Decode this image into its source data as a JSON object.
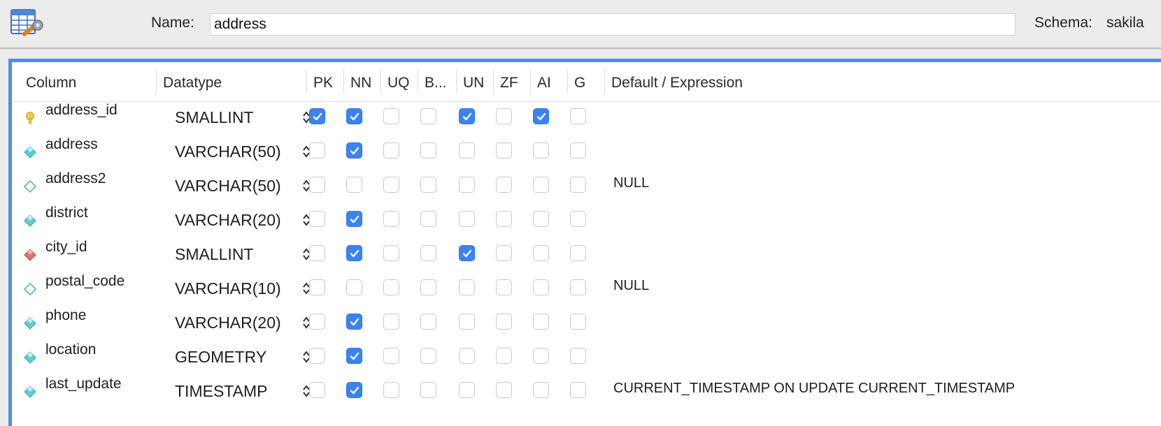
{
  "header": {
    "name_label": "Name:",
    "name_value": "address",
    "schema_label": "Schema:",
    "schema_value": "sakila",
    "icon": "table-edit-icon"
  },
  "grid": {
    "headers": {
      "column": "Column",
      "datatype": "Datatype",
      "pk": "PK",
      "nn": "NN",
      "uq": "UQ",
      "b": "B...",
      "un": "UN",
      "zf": "ZF",
      "ai": "AI",
      "g": "G",
      "default": "Default / Expression"
    },
    "rows": [
      {
        "name": "address_id",
        "datatype": "SMALLINT",
        "icon": "primary-key-icon",
        "pk": true,
        "nn": true,
        "uq": false,
        "b": false,
        "un": true,
        "zf": false,
        "ai": true,
        "g": false,
        "default": ""
      },
      {
        "name": "address",
        "datatype": "VARCHAR(50)",
        "icon": "column-not-null-icon",
        "pk": false,
        "nn": true,
        "uq": false,
        "b": false,
        "un": false,
        "zf": false,
        "ai": false,
        "g": false,
        "default": ""
      },
      {
        "name": "address2",
        "datatype": "VARCHAR(50)",
        "icon": "column-nullable-icon",
        "pk": false,
        "nn": false,
        "uq": false,
        "b": false,
        "un": false,
        "zf": false,
        "ai": false,
        "g": false,
        "default": "NULL"
      },
      {
        "name": "district",
        "datatype": "VARCHAR(20)",
        "icon": "column-not-null-icon",
        "pk": false,
        "nn": true,
        "uq": false,
        "b": false,
        "un": false,
        "zf": false,
        "ai": false,
        "g": false,
        "default": ""
      },
      {
        "name": "city_id",
        "datatype": "SMALLINT",
        "icon": "foreign-key-icon",
        "pk": false,
        "nn": true,
        "uq": false,
        "b": false,
        "un": true,
        "zf": false,
        "ai": false,
        "g": false,
        "default": ""
      },
      {
        "name": "postal_code",
        "datatype": "VARCHAR(10)",
        "icon": "column-nullable-icon",
        "pk": false,
        "nn": false,
        "uq": false,
        "b": false,
        "un": false,
        "zf": false,
        "ai": false,
        "g": false,
        "default": "NULL"
      },
      {
        "name": "phone",
        "datatype": "VARCHAR(20)",
        "icon": "column-not-null-icon",
        "pk": false,
        "nn": true,
        "uq": false,
        "b": false,
        "un": false,
        "zf": false,
        "ai": false,
        "g": false,
        "default": ""
      },
      {
        "name": "location",
        "datatype": "GEOMETRY",
        "icon": "column-not-null-icon",
        "pk": false,
        "nn": true,
        "uq": false,
        "b": false,
        "un": false,
        "zf": false,
        "ai": false,
        "g": false,
        "default": ""
      },
      {
        "name": "last_update",
        "datatype": "TIMESTAMP",
        "icon": "column-not-null-icon",
        "pk": false,
        "nn": true,
        "uq": false,
        "b": false,
        "un": false,
        "zf": false,
        "ai": false,
        "g": false,
        "default": "CURRENT_TIMESTAMP ON UPDATE CURRENT_TIMESTAMP"
      }
    ]
  },
  "colors": {
    "accent": "#3b82f6",
    "panel_border": "#4a90f0",
    "key_yellow": "#f2c94c",
    "not_null_teal": "#5ccfd6",
    "foreign_key_red": "#d9756a"
  }
}
